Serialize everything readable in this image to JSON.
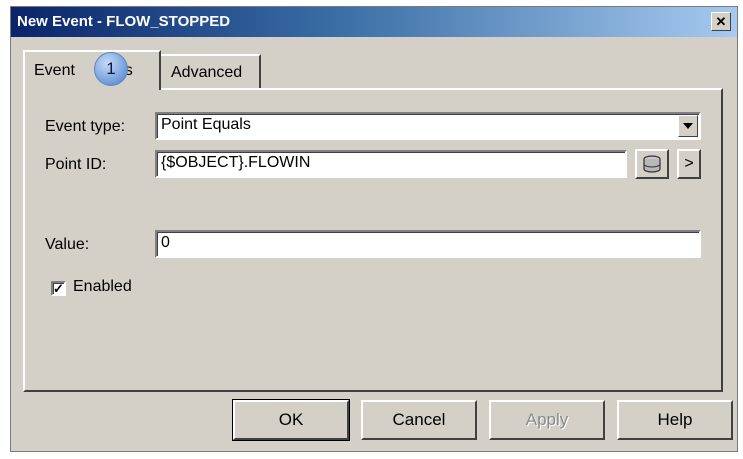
{
  "window": {
    "title": "New Event - FLOW_STOPPED",
    "close_icon": "close-icon"
  },
  "tabs": [
    {
      "label": "Event",
      "active": true
    },
    {
      "label": "tions",
      "active": false
    },
    {
      "label": "Advanced",
      "active": false
    }
  ],
  "callout": {
    "number": "1"
  },
  "form": {
    "event_type": {
      "label": "Event type:",
      "value": "Point Equals"
    },
    "point_id": {
      "label": "Point ID:",
      "value": "{$OBJECT}.FLOWIN",
      "browse_icon": "database-icon",
      "next_label": ">"
    },
    "value": {
      "label": "Value:",
      "value": "0"
    },
    "enabled": {
      "label": "Enabled",
      "checked": true,
      "mark": "✓"
    }
  },
  "buttons": {
    "ok": "OK",
    "cancel": "Cancel",
    "apply": "Apply",
    "help": "Help"
  }
}
